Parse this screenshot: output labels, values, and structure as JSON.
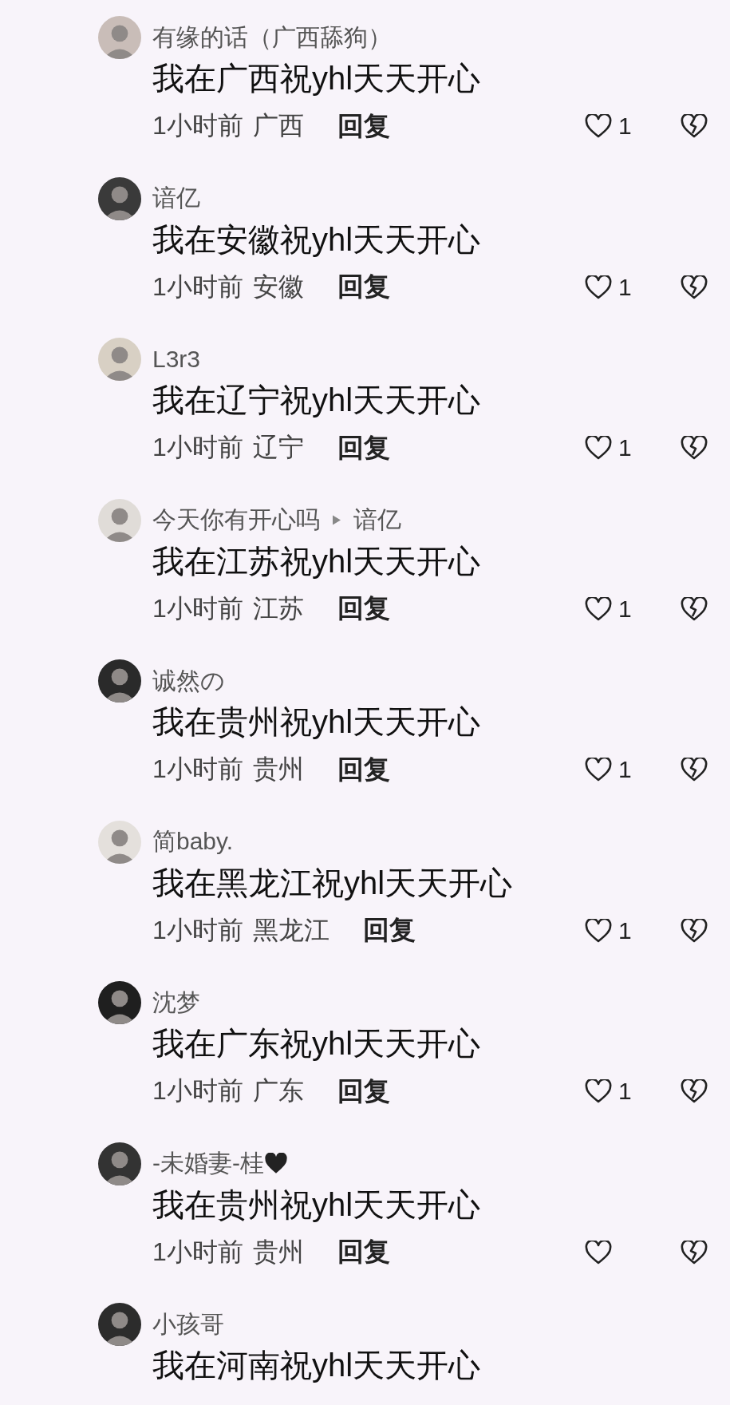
{
  "comments": [
    {
      "name": "有缘的话（广西舔狗）",
      "text": "我在广西祝yhl天天开心",
      "time": "1小时前",
      "location": "广西",
      "reply": "回复",
      "likes": "1"
    },
    {
      "name": "谙亿",
      "text": "我在安徽祝yhl天天开心",
      "time": "1小时前",
      "location": "安徽",
      "reply": "回复",
      "likes": "1"
    },
    {
      "name": "L3r3",
      "text": "我在辽宁祝yhl天天开心",
      "time": "1小时前",
      "location": "辽宁",
      "reply": "回复",
      "likes": "1"
    },
    {
      "name": "今天你有开心吗",
      "reply_to": "谙亿",
      "text": "我在江苏祝yhl天天开心",
      "time": "1小时前",
      "location": "江苏",
      "reply": "回复",
      "likes": "1"
    },
    {
      "name": "诚然の",
      "text": "我在贵州祝yhl天天开心",
      "time": "1小时前",
      "location": "贵州",
      "reply": "回复",
      "likes": "1"
    },
    {
      "name": "简baby.",
      "text": "我在黑龙江祝yhl天天开心",
      "time": "1小时前",
      "location": "黑龙江",
      "reply": "回复",
      "likes": "1"
    },
    {
      "name": "沈梦",
      "text": "我在广东祝yhl天天开心",
      "time": "1小时前",
      "location": "广东",
      "reply": "回复",
      "likes": "1"
    },
    {
      "name": "-未婚妻-桂",
      "name_icon": {
        "kind": "heart"
      },
      "text": "我在贵州祝yhl天天开心",
      "time": "1小时前",
      "location": "贵州",
      "reply": "回复"
    },
    {
      "name": "小孩哥",
      "text": "我在河南祝yhl天天开心"
    }
  ]
}
